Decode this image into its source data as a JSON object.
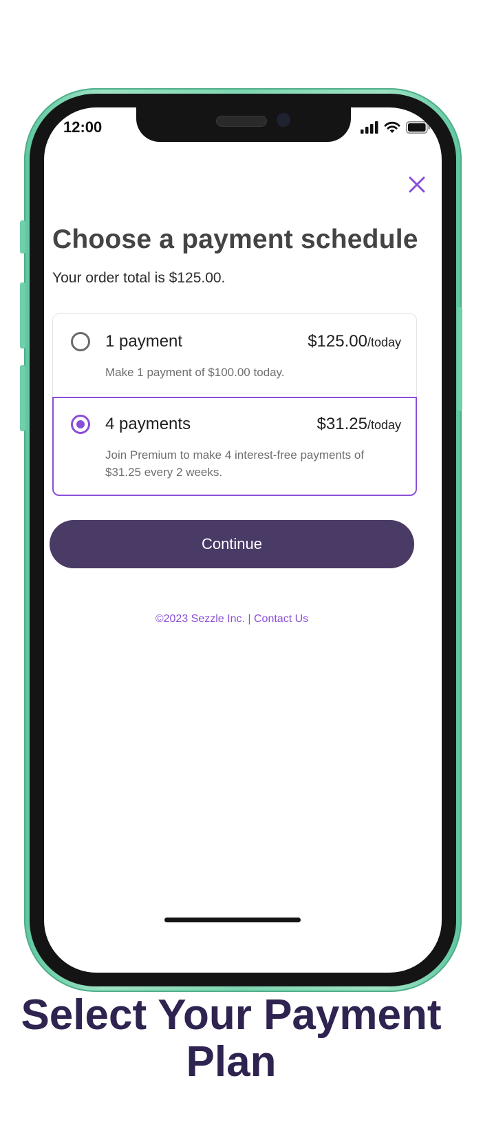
{
  "status_bar": {
    "time": "12:00"
  },
  "dialog": {
    "close_icon": "close-icon",
    "title": "Choose a payment schedule",
    "subtitle": "Your order total is $125.00.",
    "options": [
      {
        "label": "1 payment",
        "price": "$125.00",
        "price_unit": "/today",
        "description": "Make 1 payment of $100.00 today.",
        "selected": false
      },
      {
        "label": "4 payments",
        "price": "$31.25",
        "price_unit": "/today",
        "description": "Join Premium to make 4 interest-free payments of $31.25 every 2 weeks.",
        "selected": true
      }
    ],
    "continue_label": "Continue",
    "footer_copyright": "©2023 Sezzle Inc.",
    "footer_separator": "|",
    "footer_contact": "Contact Us"
  },
  "caption": "Select Your Payment Plan",
  "colors": {
    "accent": "#8a4fd6",
    "button": "#4a3a66",
    "phone_frame": "#7fd7b4",
    "caption": "#2f2350"
  }
}
